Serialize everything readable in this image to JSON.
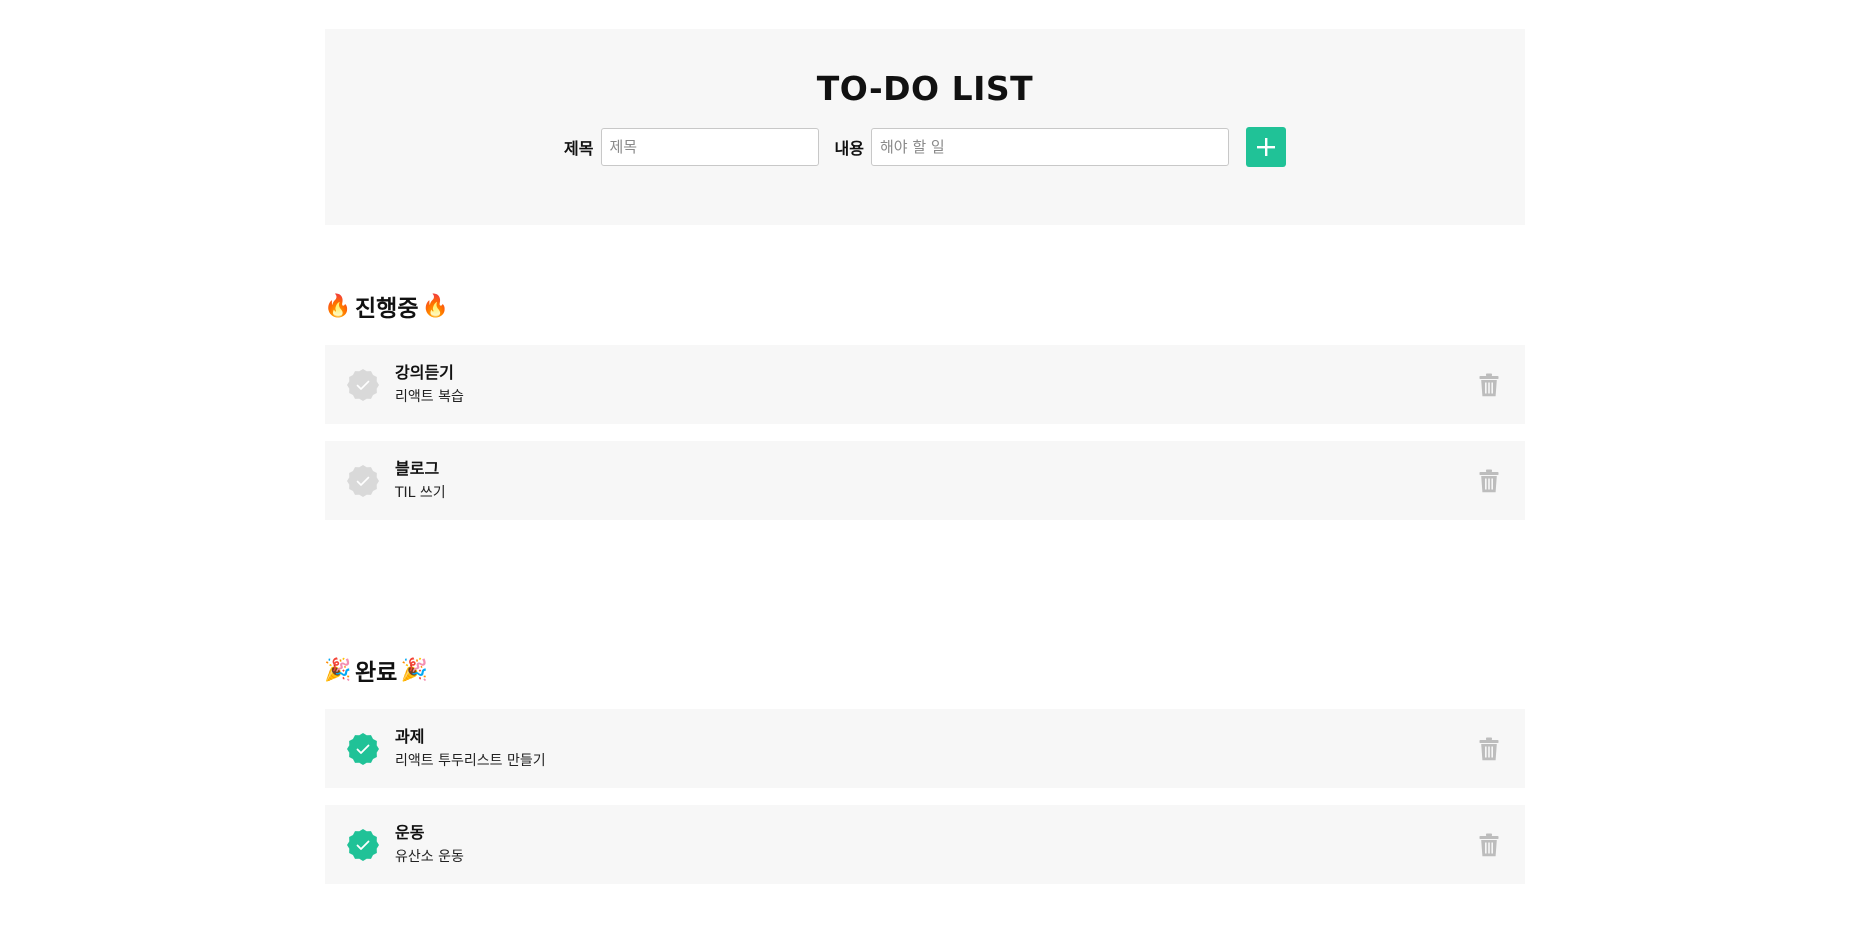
{
  "header": {
    "title": "TO-DO LIST",
    "title_label": "제목",
    "title_placeholder": "제목",
    "body_label": "내용",
    "body_placeholder": "해야 할 일",
    "add_icon": "plus-icon"
  },
  "sections": {
    "progress": {
      "emoji": "🔥",
      "heading": "진행중",
      "items": [
        {
          "title": "강의듣기",
          "body": "리액트 복습",
          "done": false
        },
        {
          "title": "블로그",
          "body": "TIL 쓰기",
          "done": false
        }
      ]
    },
    "done": {
      "emoji": "🎉",
      "heading": "완료",
      "items": [
        {
          "title": "과제",
          "body": "리액트 투두리스트 만들기",
          "done": true
        },
        {
          "title": "운동",
          "body": "유산소 운동",
          "done": true
        }
      ]
    }
  },
  "colors": {
    "accent": "#20c297",
    "check_inactive": "#d9d9d9",
    "trash": "#bdbdbd",
    "panel": "#f7f7f7"
  }
}
